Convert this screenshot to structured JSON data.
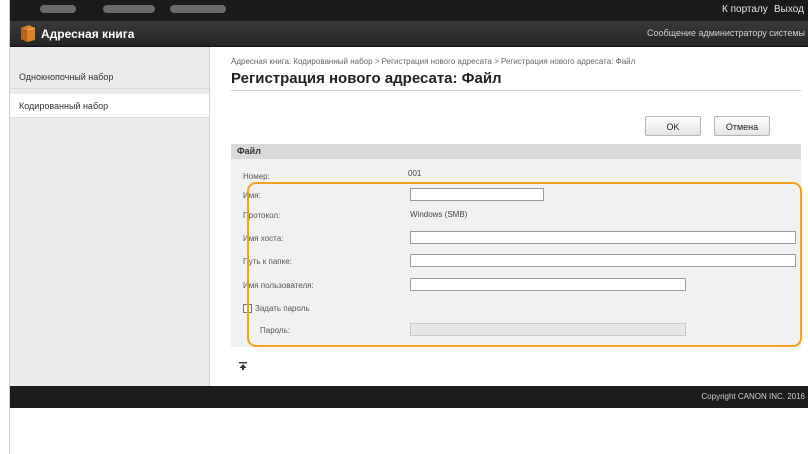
{
  "topbar": {
    "to_portal": "К порталу",
    "logout": "Выход"
  },
  "header": {
    "app_title": "Адресная книга",
    "admin_message": "Сообщение администратору системы",
    "icon": "address-book-icon"
  },
  "sidebar": {
    "items": [
      {
        "label": "Однокнопочный набор"
      },
      {
        "label": "Кодированный набор"
      }
    ]
  },
  "main": {
    "breadcrumb": "Адресная книга: Кодированный набор > Регистрация нового адресата > Регистрация нового адресата: Файл",
    "page_title": "Регистрация нового адресата: Файл",
    "ok_label": "OK",
    "cancel_label": "Отмена",
    "section_title": "Файл",
    "back_to_top_icon": "to-top-icon"
  },
  "form": {
    "number_label": "Номер:",
    "number_value": "001",
    "name_label": "Имя:",
    "name_value": "",
    "protocol_label": "Протокол:",
    "protocol_value": "Windows (SMB)",
    "host_label": "Имя хоста:",
    "host_value": "",
    "folder_label": "Путь к папке:",
    "folder_value": "",
    "user_label": "Имя пользователя:",
    "user_value": "",
    "set_password_label": "Задать пароль",
    "set_password_checked": false,
    "password_label": "Пароль:",
    "password_value": ""
  },
  "footer": {
    "copyright": "Copyright CANON INC. 2016"
  },
  "colors": {
    "highlight": "#f3a21b",
    "topbar": "#1a1a1a",
    "header": "#2e2e2e",
    "section_head": "#d9d9d9",
    "book_icon": "#d9822b"
  }
}
